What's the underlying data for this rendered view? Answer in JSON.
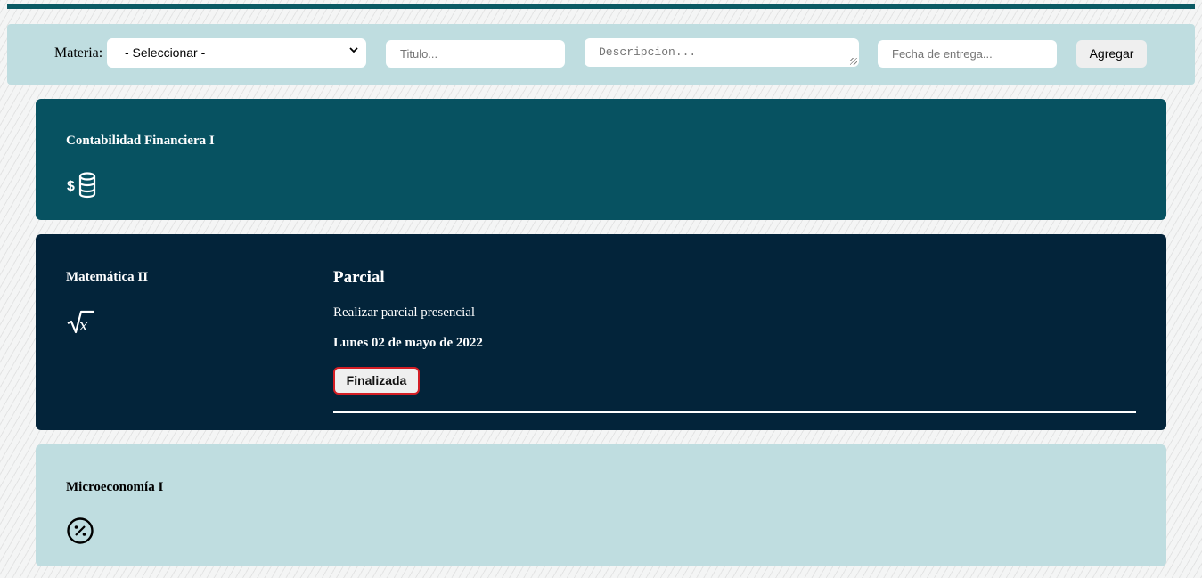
{
  "form": {
    "materia_label": "Materia:",
    "materia_select": "- Seleccionar -",
    "titulo_placeholder": "Titulo...",
    "descripcion_placeholder": "Descripcion...",
    "fecha_placeholder": "Fecha de entrega...",
    "add_button": "Agregar"
  },
  "subjects": [
    {
      "name": "Contabilidad Financiera I",
      "icon": "money-coins-icon"
    },
    {
      "name": "Matemática II",
      "icon": "square-root-icon",
      "task": {
        "title": "Parcial",
        "description": "Realizar parcial presencial",
        "due_date": "Lunes 02 de mayo de 2022",
        "status_button": "Finalizada"
      }
    },
    {
      "name": "Microeconomía I",
      "icon": "percent-circle-icon"
    }
  ],
  "colors": {
    "accent_dark_teal": "#075261",
    "navy": "#03243a",
    "light_teal": "#bfdde0",
    "status_border_red": "#d41e25"
  }
}
